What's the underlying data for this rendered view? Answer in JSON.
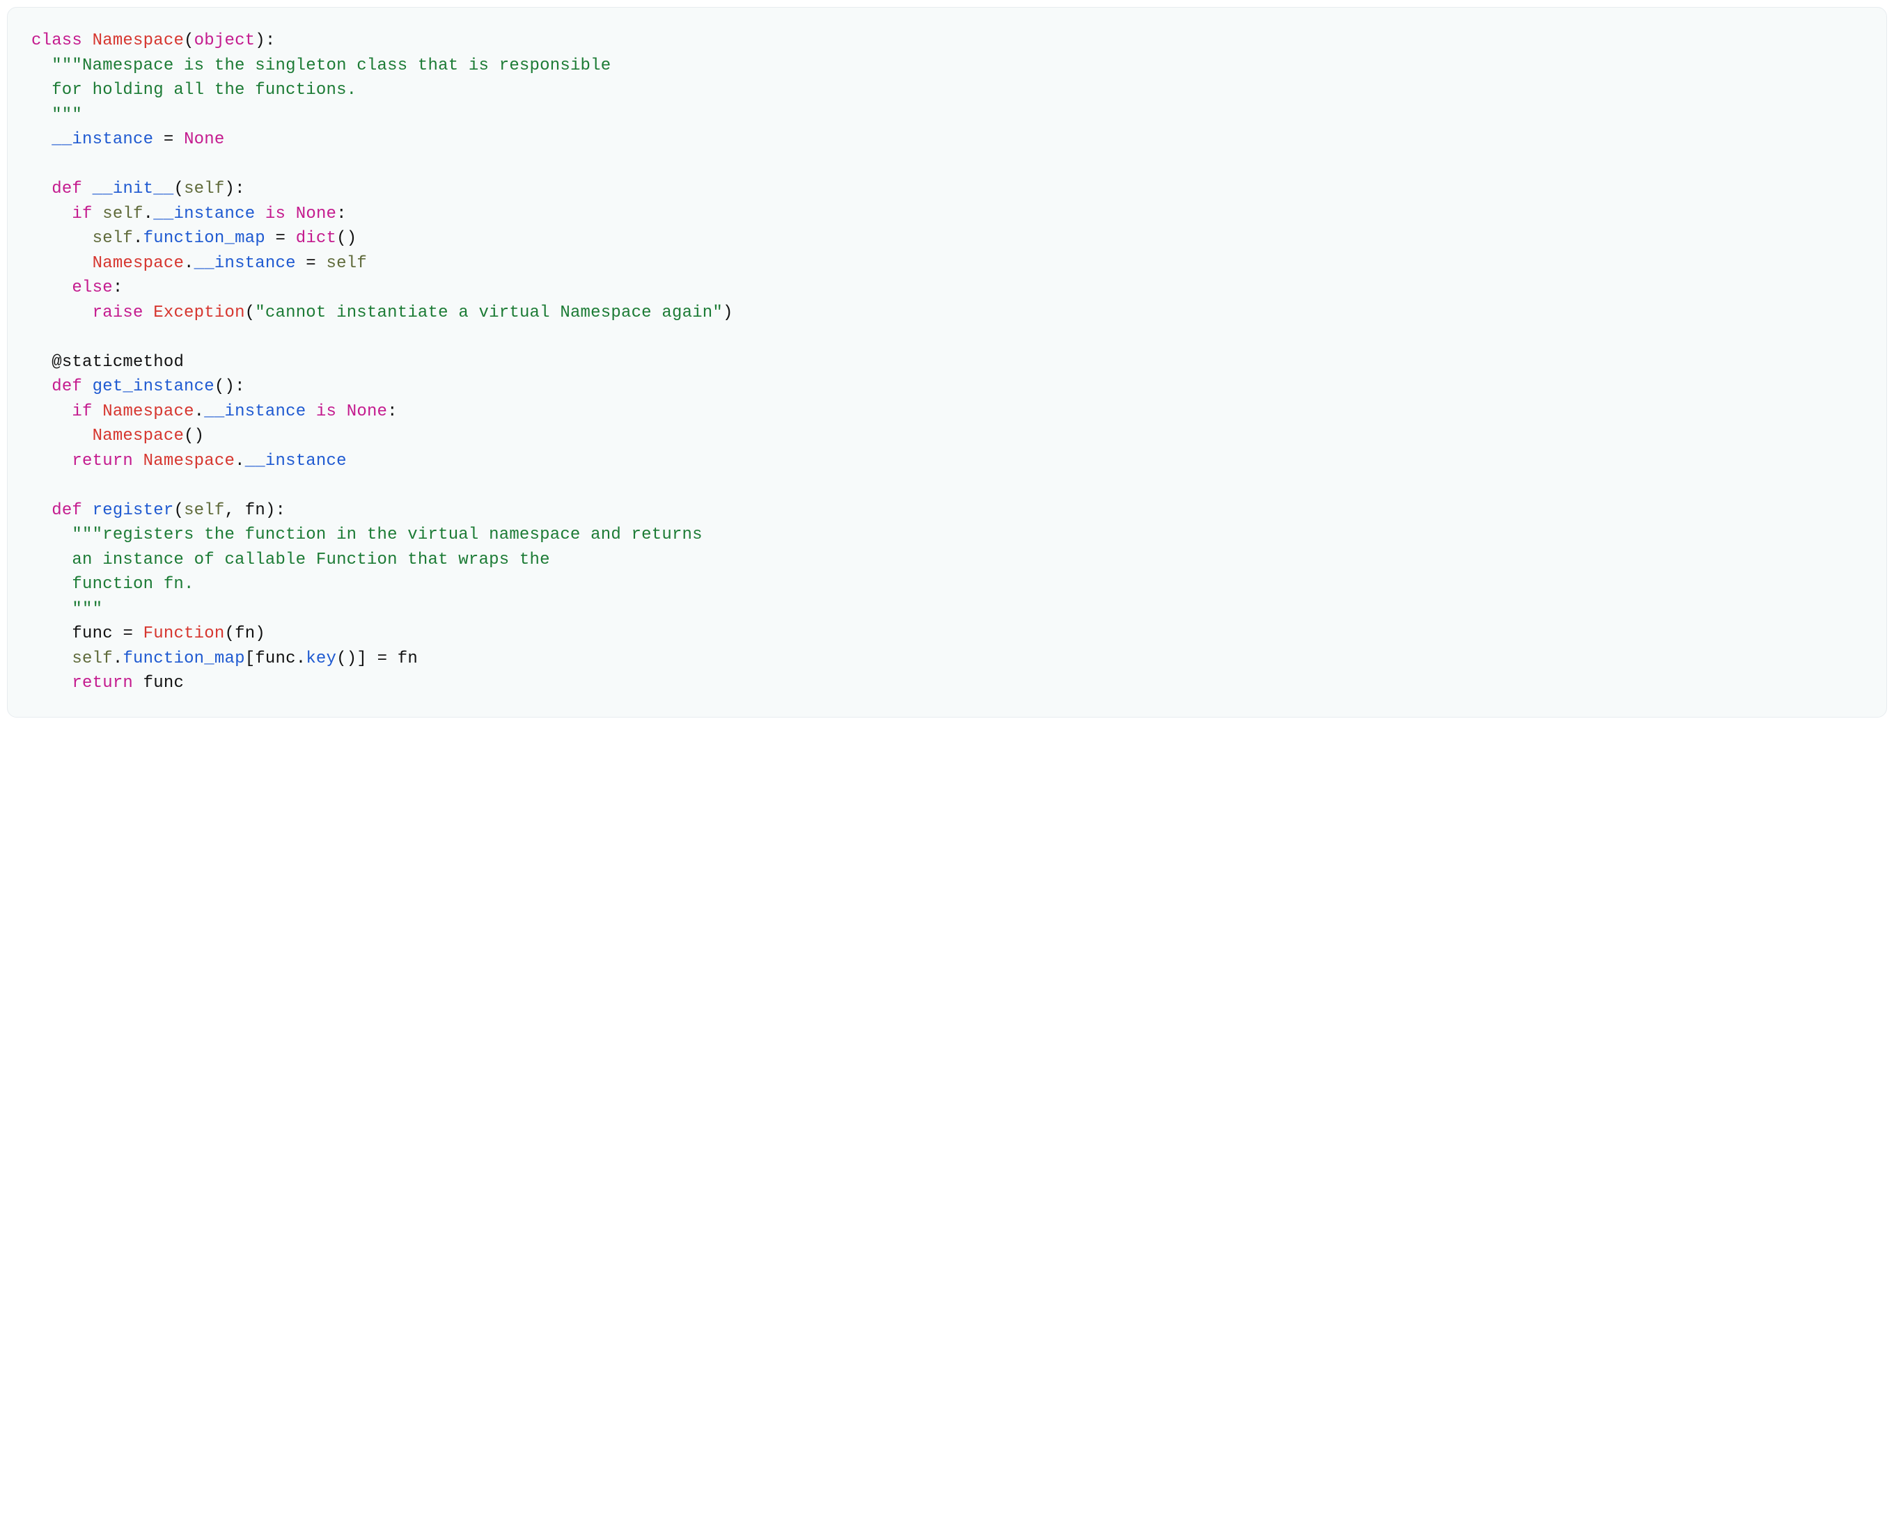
{
  "code": {
    "line1": {
      "class": "class",
      "ns": "Namespace",
      "object": "object"
    },
    "doc1a": "\"\"\"Namespace is the singleton class that is responsible",
    "doc1b": "  for holding all the functions.",
    "doc1c": "  \"\"\"",
    "instance": "__instance",
    "eq": " = ",
    "none": "None",
    "def": "def",
    "init": "__init__",
    "self": "self",
    "if": "if",
    "is": "is",
    "funcmap": "function_map",
    "dict": "dict",
    "nsinst": "__instance",
    "else": "else",
    "raise": "raise",
    "exception": "Exception",
    "excstr": "\"cannot instantiate a virtual Namespace again\"",
    "static": "@staticmethod",
    "getinst": "get_instance",
    "return": "return",
    "register": "register",
    "fn": "fn",
    "doc2a": "\"\"\"registers the function in the virtual namespace and returns",
    "doc2b": "    an instance of callable Function that wraps the",
    "doc2c": "    function fn.",
    "doc2d": "    \"\"\"",
    "func": "func",
    "Function": "Function",
    "key": "key"
  }
}
